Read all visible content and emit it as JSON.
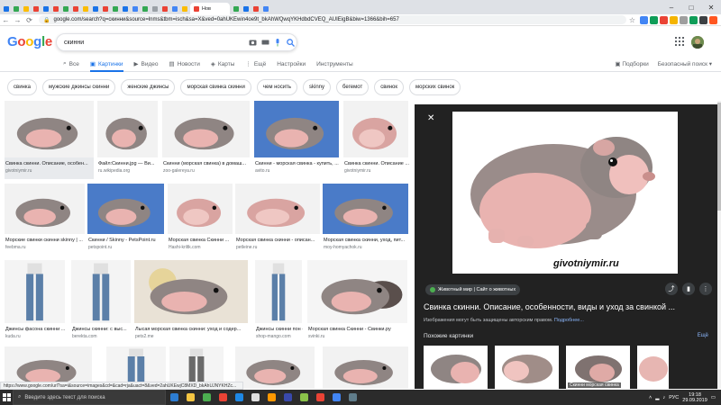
{
  "browser": {
    "active_tab_label": "Нов",
    "url": "google.com/search?q=скинни&source=lnms&tbm=isch&sa=X&ved=0ahUKEwin4oe9t_bkAhWQwqYKHdbdCVEQ_AUIEigB&biw=1366&bih=657",
    "tab_colors": [
      "#1a73e8",
      "#34a853",
      "#fbbc05",
      "#ea4335",
      "#1a73e8",
      "#ea4335",
      "#34a853",
      "#ea4335",
      "#fbbc05",
      "#1a73e8",
      "#ea4335",
      "#34a853",
      "#1a73e8",
      "#4285f4",
      "#34a853",
      "#9aa0a6",
      "#ea4335",
      "#4285f4",
      "#fbbc05",
      "#ea4335",
      "#34a853",
      "#1a73e8",
      "#ea4335",
      "#4285f4"
    ],
    "extension_colors": [
      "#4285f4",
      "#0f9d58",
      "#ea4335",
      "#f4b400",
      "#9e9e9e",
      "#0f9d58",
      "#3c4043",
      "#ff5722"
    ]
  },
  "google": {
    "logo_letters": [
      {
        "ch": "G",
        "color": "#4285f4"
      },
      {
        "ch": "o",
        "color": "#ea4335"
      },
      {
        "ch": "o",
        "color": "#fbbc05"
      },
      {
        "ch": "g",
        "color": "#4285f4"
      },
      {
        "ch": "l",
        "color": "#34a853"
      },
      {
        "ch": "e",
        "color": "#ea4335"
      }
    ],
    "query": "скинни",
    "tabs": [
      {
        "label": "Все",
        "icon": "search-icon",
        "active": false
      },
      {
        "label": "Картинки",
        "icon": "image-icon",
        "active": true
      },
      {
        "label": "Видео",
        "icon": "video-icon",
        "active": false
      },
      {
        "label": "Новости",
        "icon": "news-icon",
        "active": false
      },
      {
        "label": "Карты",
        "icon": "map-icon",
        "active": false
      },
      {
        "label": "Ещё",
        "icon": "more-icon",
        "active": false
      },
      {
        "label": "Настройки",
        "icon": "",
        "active": false
      },
      {
        "label": "Инструменты",
        "icon": "",
        "active": false
      }
    ],
    "right_links": {
      "collections": "Подборки",
      "safesearch": "Безопасный поиск ▾"
    },
    "chips": [
      "свинка",
      "мужские джинсы скинни",
      "женские джинсы",
      "морская свинка скинни",
      "чем носить",
      "skinny",
      "бегемот",
      "свинок",
      "морских свинок"
    ]
  },
  "results": [
    {
      "title": "Свинка скинни. Описание, особен...",
      "source": "givotniymir.ru",
      "kind": "pig",
      "selected": true
    },
    {
      "title": "Файл:Скинни.jpg — Ви...",
      "source": "ru.wikipedia.org",
      "kind": "pig"
    },
    {
      "title": "Скинни (морская свинка) в домаш...",
      "source": "zoo-galereya.ru",
      "kind": "pig"
    },
    {
      "title": "Скинни - морская свинка - купить, ...",
      "source": "avito.ru",
      "kind": "pig-blue"
    },
    {
      "title": "Свинка скинни. Описание ...",
      "source": "givotniymir.ru",
      "kind": "pig-pink"
    },
    {
      "title": "Морские свинки скинни skinny | ...",
      "source": "feebma.ru",
      "kind": "pig"
    },
    {
      "title": "Скинни / Skinny - PetsPoint.ru",
      "source": "petspoint.ru",
      "kind": "pig-blue"
    },
    {
      "title": "Морская свинка Скинни ...",
      "source": "Hashi-kriltk.com",
      "kind": "pig-pink"
    },
    {
      "title": "Морская свинка скинни - описан...",
      "source": "petleine.ru",
      "kind": "pig-pink"
    },
    {
      "title": "Морская свинка скинни, уход, пит...",
      "source": "moy-homyachok.ru",
      "kind": "pig-blue"
    },
    {
      "title": "Джинсы фасона скинни ...",
      "source": "kuda.ru",
      "kind": "jeans"
    },
    {
      "title": "Джинсы скинни: с выс...",
      "source": "berekta.com",
      "kind": "jeans"
    },
    {
      "title": "Лысая морская свинка скинни: уход и содер...",
      "source": "pets2.me",
      "kind": "pig-bear"
    },
    {
      "title": "Джинсы скинни пон - ...",
      "source": "shop-mango.com",
      "kind": "jeans"
    },
    {
      "title": "Морская свинка Скинни - Свинки.ру",
      "source": "svinki.ru",
      "kind": "pig-group"
    },
    {
      "title": "",
      "source": "",
      "kind": "pig"
    },
    {
      "title": "",
      "source": "",
      "kind": "jeans"
    },
    {
      "title": "",
      "source": "",
      "kind": "leggings"
    },
    {
      "title": "",
      "source": "",
      "kind": "pig"
    },
    {
      "title": "",
      "source": "",
      "kind": "pig"
    }
  ],
  "panel": {
    "watermark": "givotniymir.ru",
    "source_badge": "Животный мир | Сайт о животных",
    "title": "Свинка скинни. Описание, особенности, виды и уход за свинкой ...",
    "copyright_note": "Изображения могут быть защищены авторским правом.",
    "more_link": "Подробнее...",
    "related_label": "Похожие картинки",
    "see_all": "Ещё",
    "related_caption": "Скинни морская свинка"
  },
  "status_url": "https://www.google.com/url?sa=i&source=images&cd=&cad=rja&uact=8&ved=2ahUKEwjC8MXD_bkAhUJNYKHZc...",
  "taskbar": {
    "search_placeholder": "Введите здесь текст для поиска",
    "app_colors": [
      "#2d7dd2",
      "#f4c542",
      "#4caf50",
      "#ea4335",
      "#1e88e5",
      "#e0e0e0",
      "#ff9800",
      "#3949ab",
      "#8bc34a",
      "#ea4335",
      "#4285f4",
      "#607d8b"
    ],
    "lang": "РУС",
    "time": "19:18",
    "date": "29.09.2019"
  }
}
